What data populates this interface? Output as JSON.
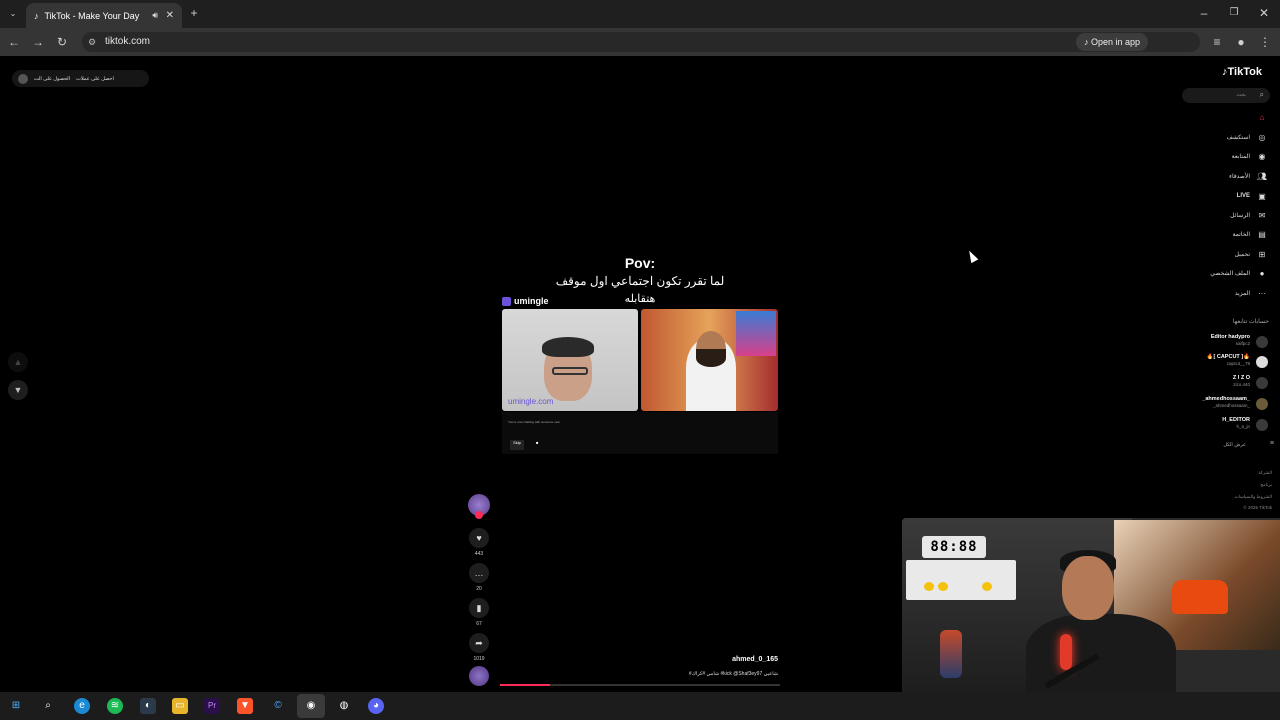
{
  "browser": {
    "tab_title": "TikTok - Make Your Day",
    "url": "tiktok.com",
    "open_in_app": "Open in app"
  },
  "promo": {
    "get_coins": "احصل على عملات",
    "get_app": "الحصول على الت"
  },
  "video": {
    "caption_title": "Pov:",
    "caption_line1": "لما تقرر تكون اجتماعي اول موقف",
    "caption_line2": "هتقابله",
    "app_brand": "umingle",
    "watermark": "umingle.com",
    "chat_text": "You're now chatting with someone new",
    "skip_label": "Skip",
    "stop_label": "■",
    "author": "ahmed_0_165",
    "tags": "#شامي #كراك #kick @Shaf3ey97 شاعيي",
    "progress": 0.18
  },
  "actions": {
    "likes": "443",
    "comments": "20",
    "saves": "67",
    "shares": "1019"
  },
  "sidebar": {
    "logo": "TikTok",
    "search_placeholder": "بحث",
    "items": [
      {
        "label": "",
        "icon": "home-icon"
      },
      {
        "label": "استكشف",
        "icon": "compass-icon"
      },
      {
        "label": "المتابعة",
        "icon": "following-icon"
      },
      {
        "label": "الأصدقاء",
        "icon": "friends-icon"
      },
      {
        "label": "LIVE",
        "icon": "live-icon"
      },
      {
        "label": "الرسائل",
        "icon": "messages-icon"
      },
      {
        "label": "الخاتمة",
        "icon": "inbox-icon"
      },
      {
        "label": "تحميل",
        "icon": "upload-icon"
      },
      {
        "label": "الملف الشخصي",
        "icon": "profile-icon"
      },
      {
        "label": "المزيد",
        "icon": "more-icon"
      }
    ],
    "following_heading": "حسابات تتابعها",
    "accounts": [
      {
        "name": "Editor hadypro",
        "handle": "salfpc2"
      },
      {
        "name": "🔥[ CAPCUT ]🔥",
        "handle": "capcut__79"
      },
      {
        "name": "Z I Z O",
        "handle": "zizo.440"
      },
      {
        "name": "_ahmedhossaam_",
        "handle": "_ahmedhossaam_"
      },
      {
        "name": "H_EDITOR",
        "handle": "h_a_jn"
      }
    ],
    "see_all": "عرض الكل",
    "footer": [
      "الشركة",
      "برنامج",
      "الشروط والسياسات",
      "© 2026 TikTok"
    ]
  },
  "webcam": {
    "clock": "88:88"
  }
}
